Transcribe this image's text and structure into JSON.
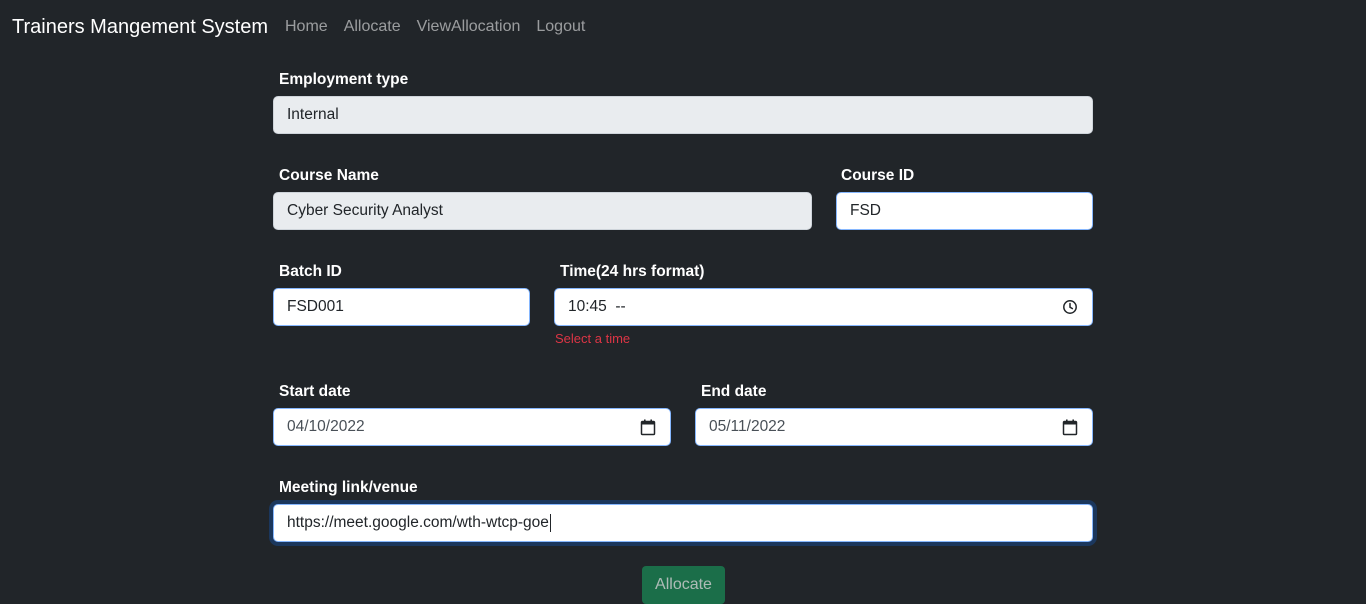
{
  "nav": {
    "brand": "Trainers Mangement System",
    "links": [
      "Home",
      "Allocate",
      "ViewAllocation",
      "Logout"
    ]
  },
  "form": {
    "employment_type": {
      "label": "Employment type",
      "value": "Internal"
    },
    "course_name": {
      "label": "Course Name",
      "value": "Cyber Security Analyst"
    },
    "course_id": {
      "label": "Course ID",
      "value": "FSD"
    },
    "batch_id": {
      "label": "Batch ID",
      "value": "FSD001"
    },
    "time": {
      "label": "Time(24 hrs format)",
      "value": "10:45  --",
      "error": "Select a time",
      "icon": "clock-icon"
    },
    "start_date": {
      "label": "Start date",
      "value": "04/10/2022",
      "icon": "calendar-icon"
    },
    "end_date": {
      "label": "End date",
      "value": "05/11/2022",
      "icon": "calendar-icon"
    },
    "meeting": {
      "label": "Meeting link/venue",
      "value": "https://meet.google.com/wth-wtcp-goe"
    },
    "submit_label": "Allocate"
  },
  "colors": {
    "background": "#212529",
    "error": "#dc3545",
    "button": "#198754"
  }
}
